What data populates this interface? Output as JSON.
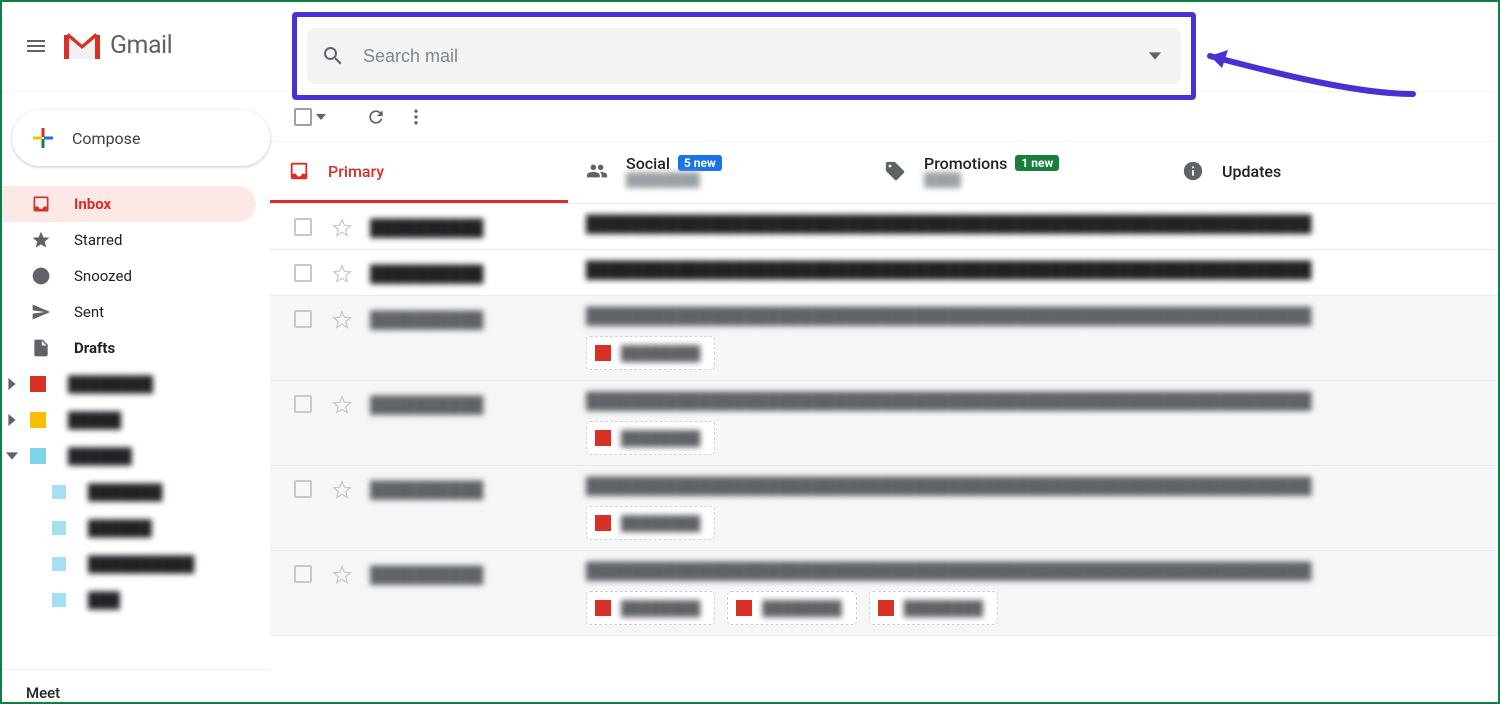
{
  "header": {
    "brand": "Gmail",
    "search_placeholder": "Search mail"
  },
  "compose": {
    "label": "Compose"
  },
  "sidebar": {
    "items": [
      {
        "icon": "inbox",
        "label": "Inbox",
        "active": true,
        "bold": true
      },
      {
        "icon": "star",
        "label": "Starred",
        "active": false,
        "bold": false
      },
      {
        "icon": "clock",
        "label": "Snoozed",
        "active": false,
        "bold": false
      },
      {
        "icon": "send",
        "label": "Sent",
        "active": false,
        "bold": false
      },
      {
        "icon": "file",
        "label": "Drafts",
        "active": false,
        "bold": true
      }
    ],
    "meet_label": "Meet"
  },
  "tabs": [
    {
      "key": "primary",
      "label": "Primary",
      "badge": null,
      "active": true
    },
    {
      "key": "social",
      "label": "Social",
      "badge": "5 new",
      "badge_color": "blue",
      "active": false
    },
    {
      "key": "promotions",
      "label": "Promotions",
      "badge": "1 new",
      "badge_color": "green",
      "active": false
    },
    {
      "key": "updates",
      "label": "Updates",
      "badge": null,
      "active": false
    }
  ],
  "emails": [
    {
      "read": false,
      "attachments": 0
    },
    {
      "read": false,
      "attachments": 0
    },
    {
      "read": true,
      "attachments": 1
    },
    {
      "read": true,
      "attachments": 1
    },
    {
      "read": true,
      "attachments": 1
    },
    {
      "read": true,
      "attachments": 3
    }
  ]
}
